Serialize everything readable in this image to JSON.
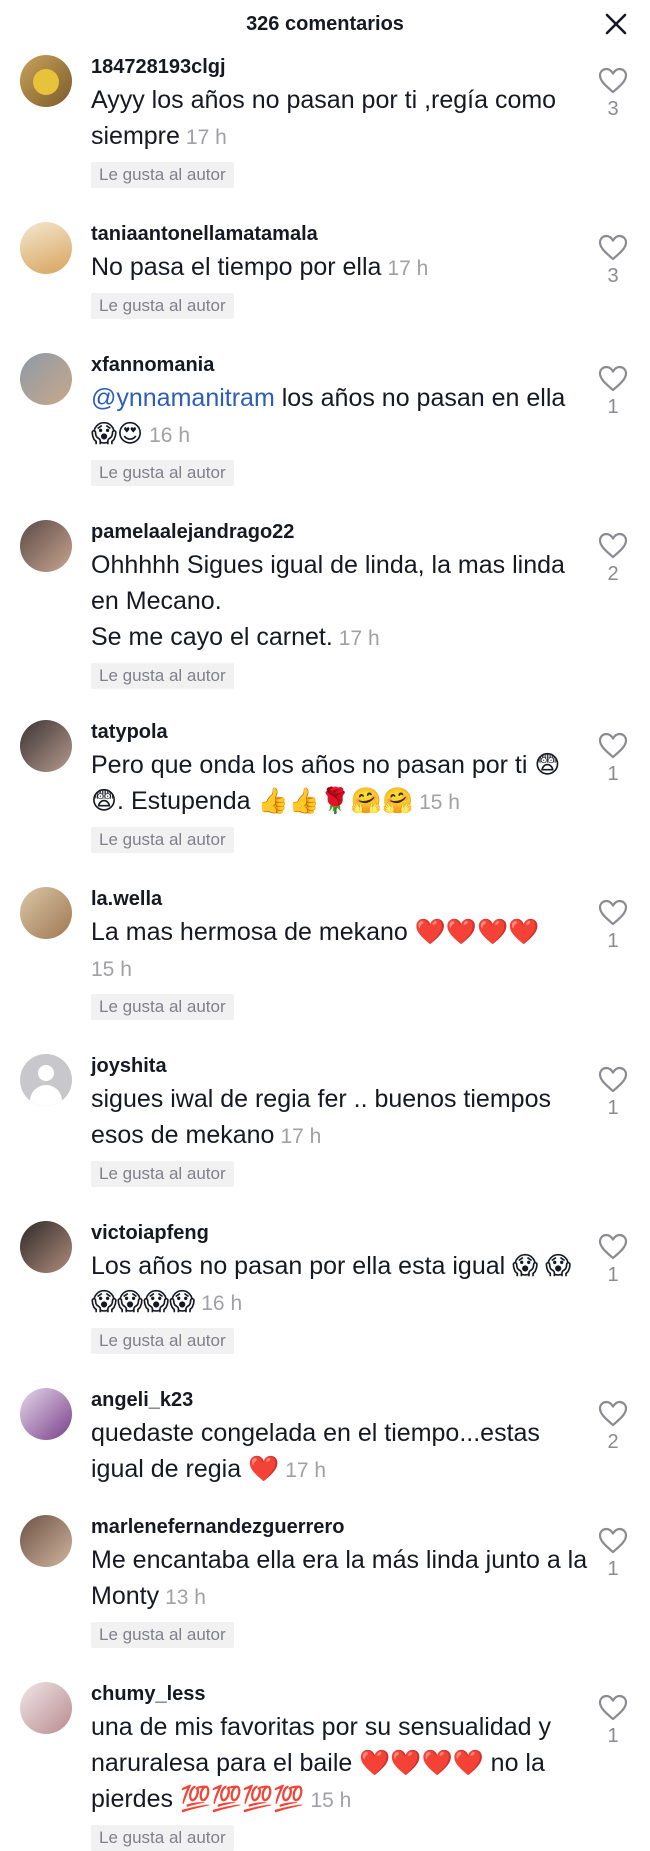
{
  "header": {
    "title": "326 comentarios"
  },
  "badge_label": "Le gusta al autor",
  "comments": [
    {
      "username": "184728193clgj",
      "text": "Ayyy los años no pasan por ti ,regía como siempre",
      "time": "17 h",
      "likes": "3",
      "liked_by_author": true
    },
    {
      "username": "taniaantonellamatamala",
      "text": "No pasa el tiempo por ella",
      "time": "17 h",
      "likes": "3",
      "liked_by_author": true
    },
    {
      "username": "xfannomania",
      "mention": "@ynnamanitram",
      "text": " los años no pasan en ella 😱😍",
      "time": "16 h",
      "likes": "1",
      "liked_by_author": true
    },
    {
      "username": "pamelaalejandrago22",
      "text": "Ohhhhh Sigues igual de linda, la mas linda en Mecano.\nSe me cayo el carnet.",
      "time": "17 h",
      "likes": "2",
      "liked_by_author": true
    },
    {
      "username": "tatypola",
      "text": "Pero que onda los años no pasan por ti 😨😨. Estupenda 👍👍🌹🤗🤗",
      "time": "15 h",
      "likes": "1",
      "liked_by_author": true
    },
    {
      "username": "la.wella",
      "text": "La mas hermosa de mekano ❤️❤️❤️❤️",
      "time": "15 h",
      "likes": "1",
      "liked_by_author": true
    },
    {
      "username": "joyshita",
      "text": "sigues iwal de regia fer .. buenos tiempos esos de mekano",
      "time": "17 h",
      "likes": "1",
      "liked_by_author": true
    },
    {
      "username": "victoiapfeng",
      "text": "Los años no pasan por ella esta igual 😱 😱😱😱😱😱",
      "time": "16 h",
      "likes": "1",
      "liked_by_author": true
    },
    {
      "username": "angeli_k23",
      "text": "quedaste congelada en el tiempo...estas igual de regia ❤️",
      "time": "17 h",
      "likes": "2",
      "liked_by_author": false
    },
    {
      "username": "marlenefernandezguerrero",
      "text": "Me encantaba ella era la más linda junto a la Monty",
      "time": "13 h",
      "likes": "1",
      "liked_by_author": true
    },
    {
      "username": "chumy_less",
      "text": "una de mis favoritas por su sensualidad y naruralesa para el baile ❤️❤️❤️❤️ no la pierdes 💯💯💯💯",
      "time": "15 h",
      "likes": "1",
      "liked_by_author": true
    }
  ],
  "colors": {
    "username": "#161823",
    "time": "#a0a0a6",
    "mention": "#2b5db9",
    "badge_bg": "#f1f1f2"
  },
  "icons": {
    "close": "close-icon",
    "like": "heart-outline-icon",
    "default_avatar": "default-avatar-icon"
  }
}
